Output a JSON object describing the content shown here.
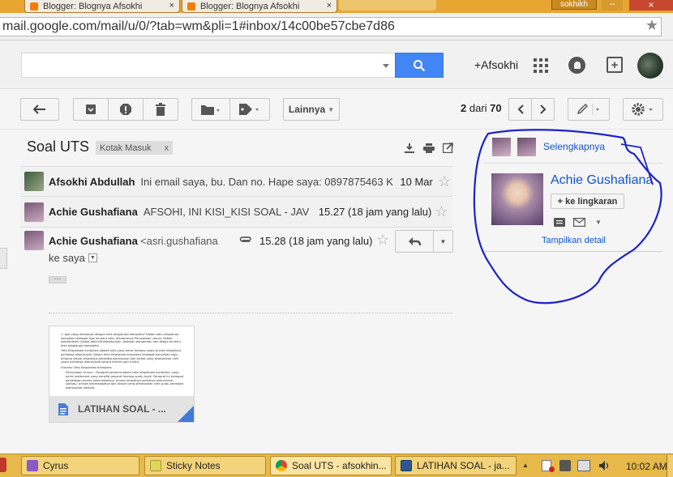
{
  "browser": {
    "tabs": [
      {
        "label": "Blogger: Blognya Afsokhi",
        "close": "×"
      },
      {
        "label": "Blogger: Blognya Afsokhi",
        "close": "×"
      }
    ],
    "user_tag": "sokhikh",
    "window_controls": {
      "minimize": "–",
      "close": "×"
    },
    "url": "mail.google.com/mail/u/0/?tab=wm&pli=1#inbox/14c00be57cbe7d86",
    "url_prefix_hidden": "m"
  },
  "header": {
    "account_link": "+Afsokhi"
  },
  "toolbar": {
    "more_label": "Lainnya",
    "pager_current": "2",
    "pager_sep": "dari",
    "pager_total": "70"
  },
  "thread": {
    "subject": "Soal UTS",
    "label": "Kotak Masuk",
    "label_remove": "x",
    "messages": [
      {
        "sender": "Afsokhi Abdullah",
        "snippet": "Ini email saya, bu. Dan no. Hape saya: 0897875463 K",
        "time": "10 Mar"
      },
      {
        "sender": "Achie Gushafiana",
        "snippet": "AFSOHI, INI KISI_KISI SOAL - JAV",
        "time": "15.27 (18 jam yang lalu)"
      }
    ],
    "open_message": {
      "sender": "Achie Gushafiana",
      "email_partial": "<asri.gushafiana",
      "time": "15.28 (18 jam yang lalu)",
      "to": "ke saya",
      "ellipsis": "···"
    },
    "attachment": {
      "name": "LATIHAN SOAL - ...",
      "preview_title": "1. Apa yang dimaksud dengan teks eksplanasi kompleks? Dalam teks eksplanasi kompleks terdapat tiga struktur teks, diantaranya Pernyataan umum, Sebab akibat/deret, Akibat akhir/inti/kesimpulan. Jelaskan pengertian dari ketiga struktur teks eksplanasi kompleks!",
      "preview_para": "Teks Eksplanasi kompleks adalah teks yang berisi tentang suatu proses terjadinya peristiwa alam/sosial. Dalam teks eksplanasi kompleks terdapat penyebab logis tentang sebab terjadinya peristiwa alam/sosial dan akibat yang disebabkan oleh suatu peristiwa alam/sosial secara tertulis dan runtut.",
      "preview_heading": "Struktur Teks Eksplanasi Kompleks",
      "preview_item": "Pernyataan Umum : Paragraf pertama dalam teks eksplanasi kompleks, yang berisi statement yang bersifat general tentang suatu topik. Paragraf ini terdapat penjelasan proses keberadaanya, proses terjadinya peristiwa alam/sosial (sebab), proses keberadaanya dan akibat yang ditimbulkan oleh suatu peristiwa alam/sosial (akibat)."
    }
  },
  "sidebar": {
    "more_link": "Selengkapnya",
    "contact_name": "Achie Gushafiana",
    "add_circle": "+ ke lingkaran",
    "show_details": "Tampilkan detail"
  },
  "taskbar": {
    "items": [
      {
        "label": "Cyrus"
      },
      {
        "label": "Sticky Notes"
      },
      {
        "label": "Soal UTS - afsokhin..."
      },
      {
        "label": "LATIHAN SOAL - ja..."
      }
    ],
    "clock": "10:02 AM"
  },
  "colors": {
    "accent_blue": "#4285f4",
    "annotation_ink": "#1e22c8",
    "taskbar": "#e7b84a",
    "tabbar": "#e8a531"
  }
}
